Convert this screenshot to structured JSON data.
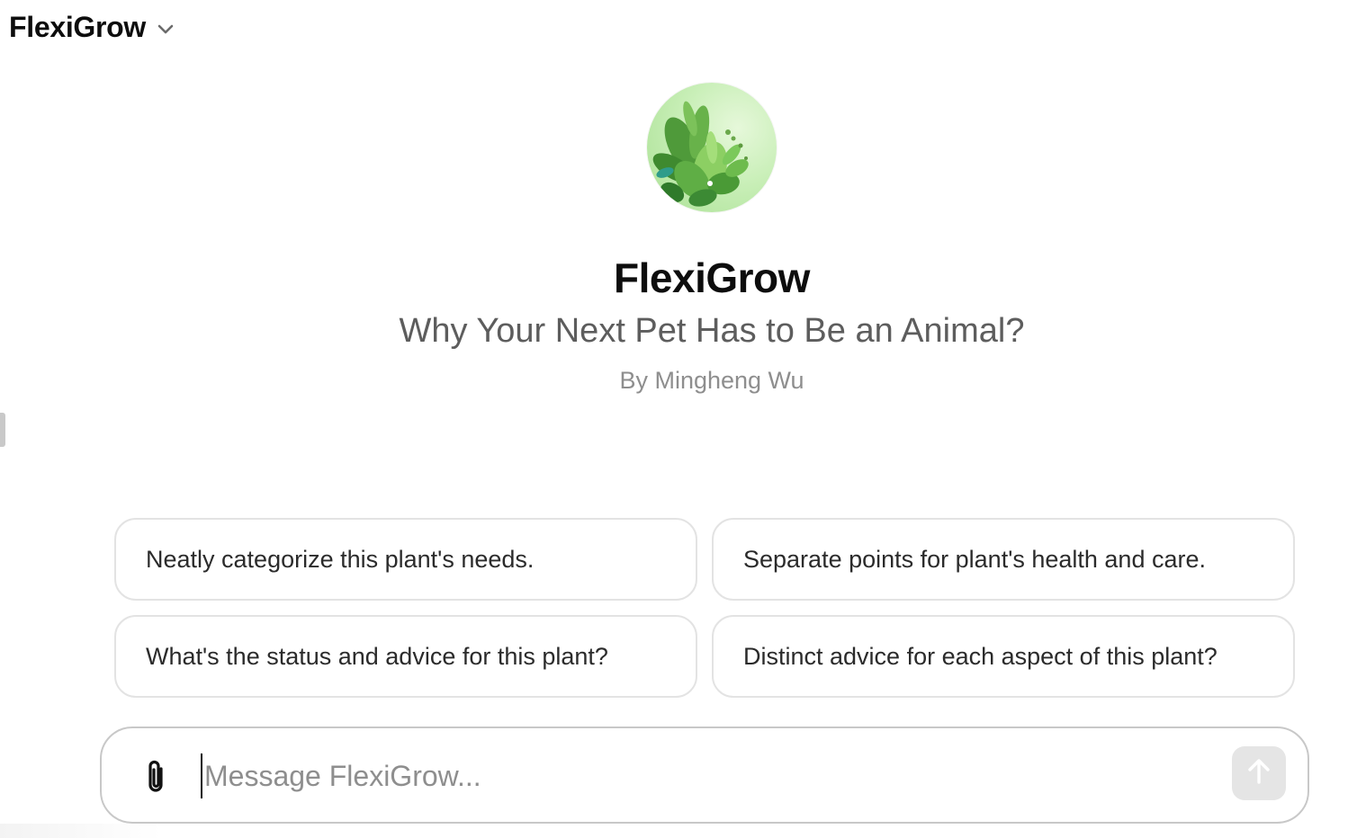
{
  "header": {
    "model_name": "FlexiGrow",
    "chevron_icon": "chevron-down-icon"
  },
  "hero": {
    "avatar_icon": "plant-leaves-avatar",
    "title": "FlexiGrow",
    "description": "Why Your Next Pet Has to Be an Animal?",
    "author": "By Mingheng Wu"
  },
  "suggestions": [
    {
      "label": "Neatly categorize this plant's needs."
    },
    {
      "label": "Separate points for plant's health and care."
    },
    {
      "label": "What's the status and advice for this plant?"
    },
    {
      "label": "Distinct advice for each aspect of this plant?"
    }
  ],
  "composer": {
    "attach_icon": "paperclip-icon",
    "placeholder": "Message FlexiGrow...",
    "value": "",
    "send_icon": "arrow-up-icon"
  },
  "colors": {
    "title": "#0d0d0d",
    "description": "#5d5d5d",
    "author": "#8e8e8e",
    "border": "#e3e3e3",
    "send_bg": "#e5e5e5",
    "avatar_green": "#a9e093"
  }
}
